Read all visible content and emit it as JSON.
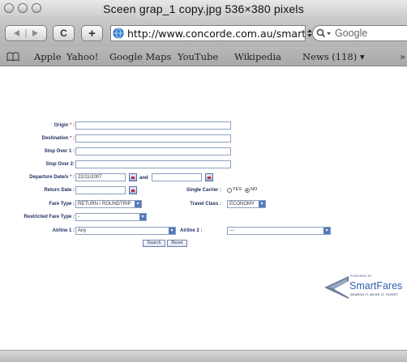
{
  "window": {
    "title": "Sceen grap_1 copy.jpg 536×380 pixels"
  },
  "toolbar": {
    "url": "http://www.concorde.com.au/smartwe",
    "search_placeholder": "Google",
    "reload_label": "C",
    "add_label": "+"
  },
  "bookmarks": {
    "items": [
      "Apple",
      "Yahoo!",
      "Google Maps",
      "YouTube",
      "Wikipedia",
      "News (118) ▾"
    ],
    "overflow": "»"
  },
  "form": {
    "origin_label": "Origin",
    "destination_label": "Destination",
    "stopover1_label": "Stop Over 1 :",
    "stopover2_label": "Stop Over 2:",
    "departure_label": "Departure Date/s",
    "departure_value": "22/11/2007",
    "and_label": "and",
    "return_label": "Return Date :",
    "single_carrier_label": "Single Carrier :",
    "radio_yes": "YES",
    "radio_no": "NO",
    "fare_type_label": "Fare Type :",
    "fare_type_value": "RETURN / ROUNDTRIP",
    "travel_class_label": "Travel Class :",
    "travel_class_value": "ECONOMY",
    "restricted_label": "Restricted Fare Type :",
    "restricted_value": "-",
    "airline1_label": "Airline 1 :",
    "airline1_value": "Any",
    "airline2_label": "Airline 2 :",
    "airline2_value": "---",
    "search_button": "Search",
    "reset_button": "Reset"
  },
  "logo": {
    "powered_by": "POWERED BY",
    "name": "SmartFares",
    "tagline": "SEARCH IT, BOOK IT, TICKET"
  },
  "colors": {
    "label": "#1d2b5e",
    "brand": "#2f5fb0",
    "required": "#c04040"
  }
}
